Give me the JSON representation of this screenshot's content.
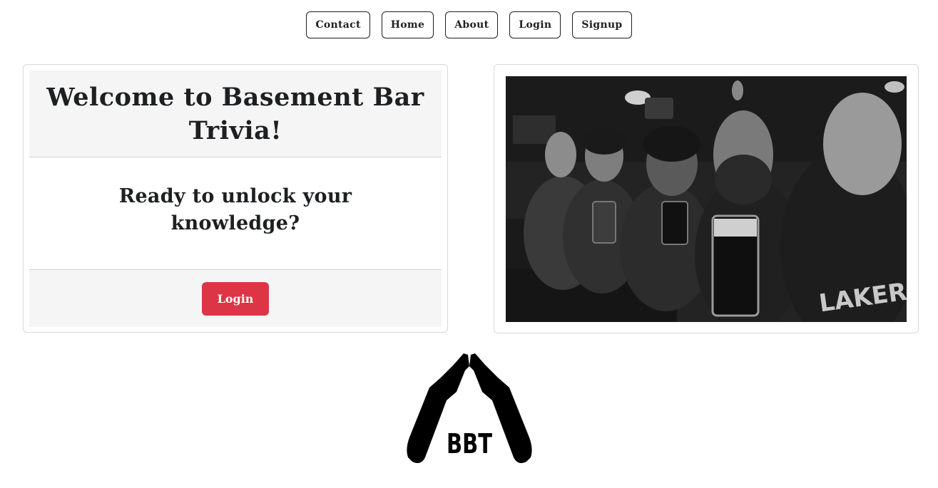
{
  "nav": {
    "items": [
      {
        "label": "Contact"
      },
      {
        "label": "Home"
      },
      {
        "label": "About"
      },
      {
        "label": "Login"
      },
      {
        "label": "Signup"
      }
    ]
  },
  "welcome_card": {
    "title": "Welcome to Basement Bar Trivia!",
    "subtitle": "Ready to unlock your knowledge?",
    "login_button": "Login",
    "button_color": "#dc3545"
  },
  "photo": {
    "description_icon": "group-photo-image"
  },
  "logo": {
    "text": "BBT"
  }
}
